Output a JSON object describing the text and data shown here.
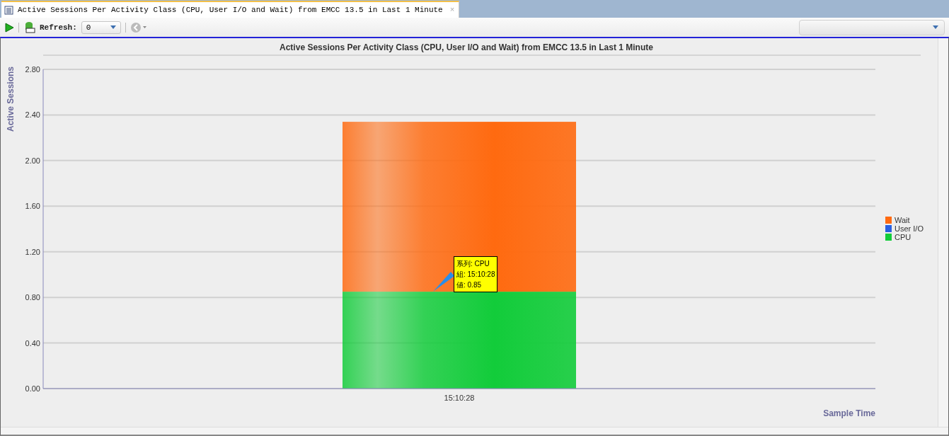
{
  "tab": {
    "title": "Active Sessions Per Activity Class (CPU, User I/O and Wait) from EMCC 13.5 in Last 1 Minute",
    "close": "×"
  },
  "toolbar": {
    "refresh_label": "Refresh:",
    "refresh_value": "0"
  },
  "chart": {
    "tooltip": {
      "lines": [
        "系列: CPU",
        "組: 15:10:28",
        "値: 0.85"
      ]
    },
    "chart_data": {
      "type": "bar",
      "title": "Active Sessions Per Activity Class (CPU, User I/O and Wait) from EMCC 13.5 in Last 1 Minute",
      "xlabel": "Sample Time",
      "ylabel": "Active Sessions",
      "categories": [
        "15:10:28"
      ],
      "stacked": true,
      "grid": true,
      "legend": "right",
      "series": [
        {
          "name": "Wait",
          "color": "#ff6a10",
          "values": [
            1.49
          ]
        },
        {
          "name": "User I/O",
          "color": "#2a5fe0",
          "values": [
            0
          ]
        },
        {
          "name": "CPU",
          "color": "#12cc3a",
          "values": [
            0.85
          ]
        }
      ],
      "ylim": [
        0,
        2.8
      ],
      "yticks": [
        {
          "value": 0,
          "label": "0.00"
        },
        {
          "value": 0.4,
          "label": "0.40"
        },
        {
          "value": 0.8,
          "label": "0.80"
        },
        {
          "value": 1.2,
          "label": "1.20"
        },
        {
          "value": 1.6,
          "label": "1.60"
        },
        {
          "value": 2,
          "label": "2.00"
        },
        {
          "value": 2.4,
          "label": "2.40"
        },
        {
          "value": 2.8,
          "label": "2.80"
        }
      ]
    }
  }
}
